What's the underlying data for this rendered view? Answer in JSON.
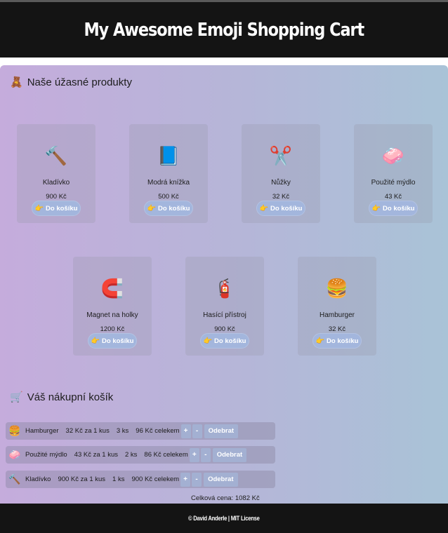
{
  "header": {
    "title": "My Awesome Emoji Shopping Cart"
  },
  "products_section": {
    "icon": "🧸",
    "title": "Naše úžasné produkty"
  },
  "add_button": {
    "hand": "👉",
    "label": "Do košíku"
  },
  "products": [
    {
      "emoji": "🔨",
      "name": "Kladívko",
      "price": "900 Kč"
    },
    {
      "emoji": "📘",
      "name": "Modrá knížka",
      "price": "500 Kč"
    },
    {
      "emoji": "✂️",
      "name": "Nůžky",
      "price": "32 Kč"
    },
    {
      "emoji": "🧼",
      "name": "Použité mýdlo",
      "price": "43 Kč"
    },
    {
      "emoji": "🧲",
      "name": "Magnet na holky",
      "price": "1200 Kč"
    },
    {
      "emoji": "🧯",
      "name": "Hasící přístroj",
      "price": "900 Kč"
    },
    {
      "emoji": "🍔",
      "name": "Hamburger",
      "price": "32 Kč"
    }
  ],
  "cart_section": {
    "icon": "🛒",
    "title": "Váš nákupní košík"
  },
  "cart_buttons": {
    "plus": "+",
    "minus": "-",
    "remove": "Odebrat"
  },
  "cart": [
    {
      "emoji": "🍔",
      "name": "Hamburger",
      "unit": "32 Kč za 1 kus",
      "qty": "3 ks",
      "total": "96 Kč celekem"
    },
    {
      "emoji": "🧼",
      "name": "Použité mýdlo",
      "unit": "43 Kč za 1 kus",
      "qty": "2 ks",
      "total": "86 Kč celekem"
    },
    {
      "emoji": "🔨",
      "name": "Kladívko",
      "unit": "900 Kč za 1 kus",
      "qty": "1 ks",
      "total": "900 Kč celekem"
    }
  ],
  "total": "Celková cena: 1082 Kč",
  "footer": {
    "text": "© David Anderle | MIT License"
  }
}
